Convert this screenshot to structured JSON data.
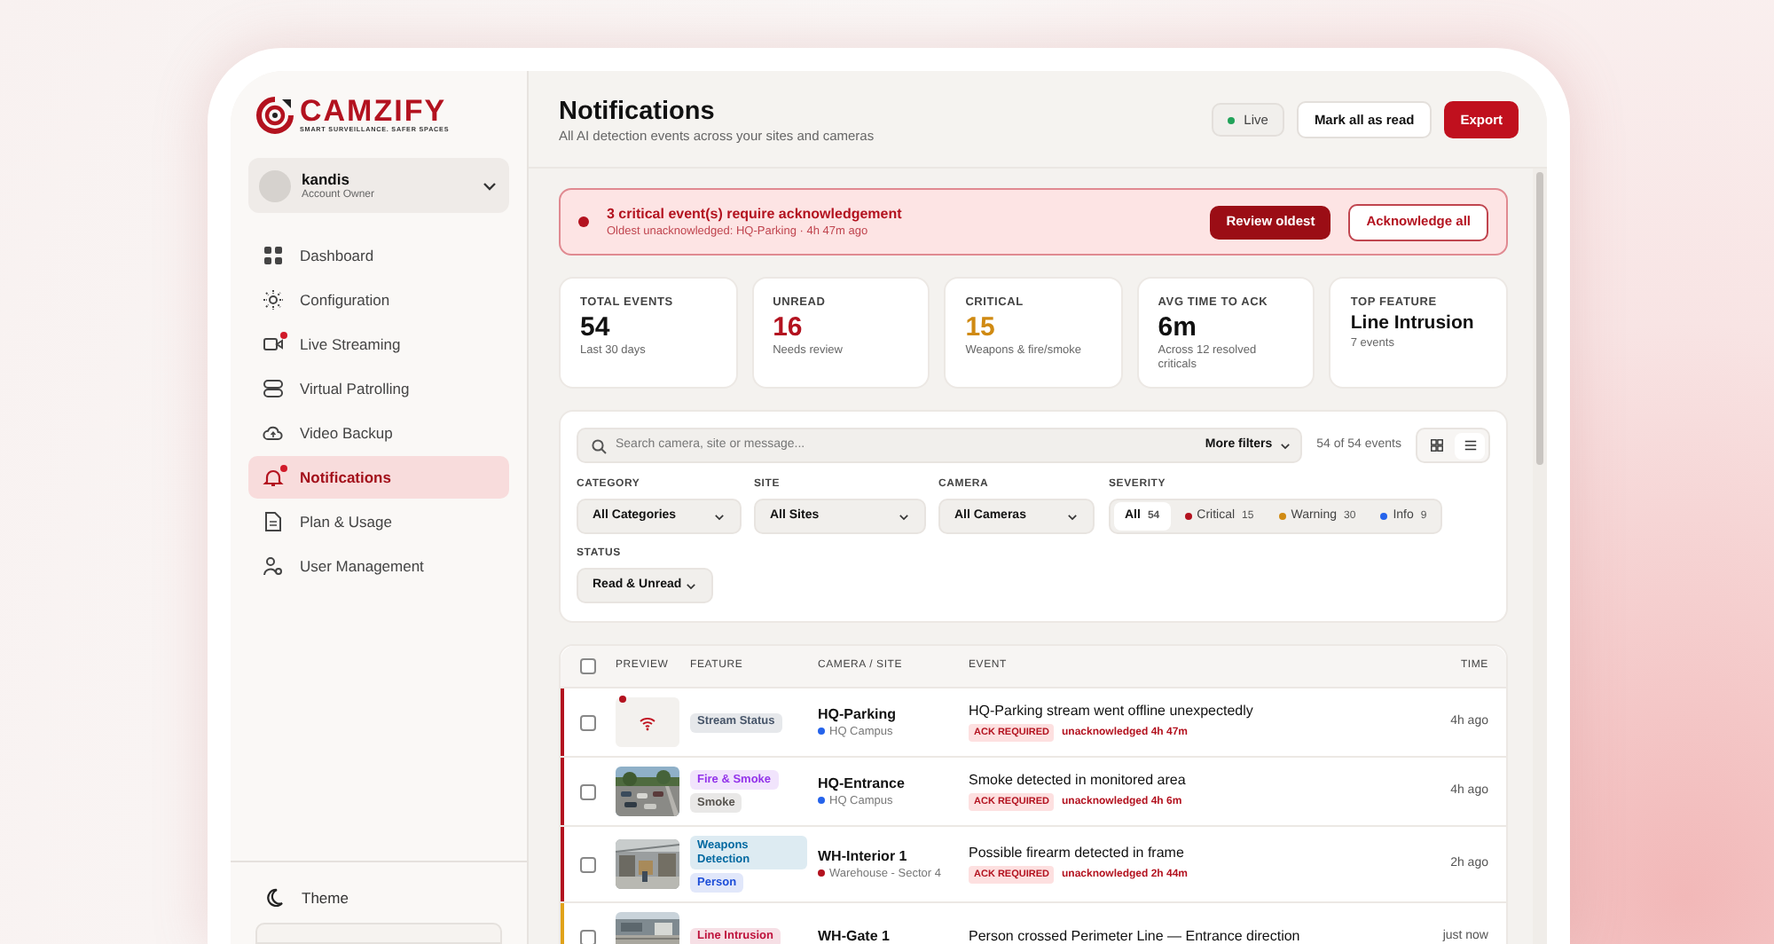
{
  "brand": {
    "name": "CAMZIFY",
    "tagline": "SMART SURVEILLANCE. SAFER SPACES"
  },
  "account": {
    "name": "kandis",
    "role": "Account Owner"
  },
  "sidebar": {
    "items": [
      {
        "label": "Dashboard",
        "kind": "grid",
        "selected": false,
        "badge": false
      },
      {
        "label": "Configuration",
        "kind": "sun",
        "selected": false,
        "badge": false
      },
      {
        "label": "Live Streaming",
        "kind": "video",
        "selected": false,
        "badge": true
      },
      {
        "label": "Virtual Patrolling",
        "kind": "server",
        "selected": false,
        "badge": false
      },
      {
        "label": "Video Backup",
        "kind": "cloud",
        "selected": false,
        "badge": false
      },
      {
        "label": "Notifications",
        "kind": "bell",
        "selected": true,
        "badge": true
      },
      {
        "label": "Plan & Usage",
        "kind": "doc",
        "selected": false,
        "badge": false
      },
      {
        "label": "User Management",
        "kind": "users",
        "selected": false,
        "badge": false
      }
    ]
  },
  "theme": {
    "label": "Theme"
  },
  "header": {
    "title": "Notifications",
    "subtitle": "All AI detection events across your sites and cameras",
    "live": "Live",
    "buttons": [
      "Mark all as read",
      "Export"
    ]
  },
  "alert": {
    "title": "3 critical event(s) require acknowledgement",
    "subtitle": "Oldest unacknowledged: HQ-Parking · 4h 47m ago",
    "buttons": [
      "Review oldest",
      "Acknowledge all"
    ]
  },
  "stats": [
    {
      "label": "TOTAL EVENTS",
      "value": "54",
      "note": "Last 30 days",
      "color": "#111111",
      "kind": "metric"
    },
    {
      "label": "UNREAD",
      "value": "16",
      "note": "Needs review",
      "color": "#b3121f",
      "kind": "metric"
    },
    {
      "label": "CRITICAL",
      "value": "15",
      "note": "Weapons & fire/smoke",
      "color": "#d08a12",
      "kind": "metric"
    },
    {
      "label": "AVG TIME TO ACK",
      "value": "6m",
      "note": "Across 12 resolved criticals",
      "color": "#111111",
      "kind": "metric"
    },
    {
      "label": "TOP FEATURE",
      "value": "Line Intrusion",
      "note": "7 events",
      "color": "#111111",
      "kind": "feature"
    }
  ],
  "filters": {
    "search": {
      "placeholder": "Search camera, site or message..."
    },
    "more_filters": "More filters",
    "count": "54 of 54 events",
    "view_toggle": [
      {
        "kind": "grid",
        "selected": false
      },
      {
        "kind": "list",
        "selected": true
      }
    ],
    "selects": [
      {
        "label": "CATEGORY",
        "value": "All Categories"
      },
      {
        "label": "SITE",
        "value": "All Sites"
      },
      {
        "label": "CAMERA",
        "value": "All Cameras"
      }
    ],
    "severity": {
      "label": "SEVERITY",
      "options": [
        {
          "label": "All",
          "count": "54",
          "selected": true
        },
        {
          "label": "Critical",
          "count": "15",
          "color": "#b3121f",
          "selected": false
        },
        {
          "label": "Warning",
          "count": "30",
          "color": "#d08a12",
          "selected": false
        },
        {
          "label": "Info",
          "count": "9",
          "color": "#2563eb",
          "selected": false
        }
      ]
    },
    "status": {
      "label": "STATUS",
      "value": "Read & Unread"
    }
  },
  "table": {
    "checked": false,
    "columns": [
      "PREVIEW",
      "FEATURE",
      "CAMERA / SITE",
      "EVENT",
      "TIME"
    ],
    "rows": [
      {
        "color": "#b3121f",
        "checked": false,
        "preview": {
          "kind": "signal",
          "unread": true
        },
        "tags": [
          {
            "label": "Stream Status",
            "color": "#475569"
          }
        ],
        "camera": "HQ-Parking",
        "site": {
          "name": "HQ Campus",
          "color": "#2563eb"
        },
        "event": "HQ-Parking stream went offline unexpectedly",
        "ack": "ACK REQUIRED",
        "ack_note": "unacknowledged 4h 47m",
        "time": "4h ago"
      },
      {
        "color": "#b3121f",
        "checked": false,
        "preview": {
          "kind": "picture",
          "unread": false
        },
        "tags": [
          {
            "label": "Fire & Smoke",
            "color": "#9333ea"
          },
          {
            "label": "Smoke",
            "color": "#57534e"
          }
        ],
        "camera": "HQ-Entrance",
        "site": {
          "name": "HQ Campus",
          "color": "#2563eb"
        },
        "event": "Smoke detected in monitored area",
        "ack": "ACK REQUIRED",
        "ack_note": "unacknowledged 4h 6m",
        "time": "4h ago"
      },
      {
        "color": "#b3121f",
        "checked": false,
        "preview": {
          "kind": "picture",
          "unread": false
        },
        "tags": [
          {
            "label": "Weapons Detection",
            "color": "#0369a1"
          },
          {
            "label": "Person",
            "color": "#1d4ed8"
          }
        ],
        "camera": "WH-Interior 1",
        "site": {
          "name": "Warehouse - Sector 4",
          "color": "#b3121f"
        },
        "event": "Possible firearm detected in frame",
        "ack": "ACK REQUIRED",
        "ack_note": "unacknowledged 2h 44m",
        "time": "2h ago"
      },
      {
        "color": "#e0a21a",
        "checked": false,
        "preview": {
          "kind": "picture",
          "unread": false
        },
        "tags": [
          {
            "label": "Line Intrusion",
            "color": "#be123c"
          }
        ],
        "camera": "WH-Gate 1",
        "event": "Person crossed Perimeter Line — Entrance direction",
        "time": "just now"
      }
    ]
  }
}
